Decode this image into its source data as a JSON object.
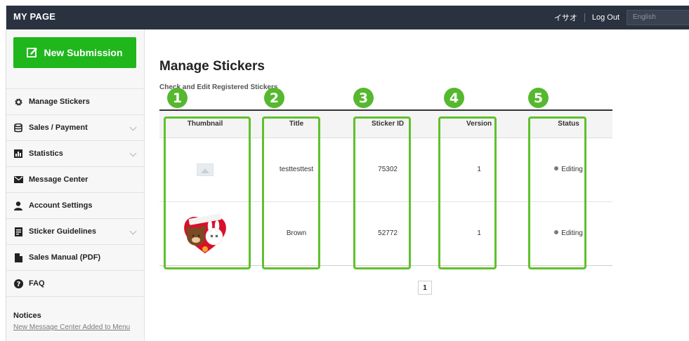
{
  "header": {
    "brand": "MY PAGE",
    "user_name": "イサオ",
    "logout": "Log Out",
    "language": "English"
  },
  "sidebar": {
    "new_submission": "New Submission",
    "items": [
      {
        "label": "Manage Stickers",
        "icon": "gear-icon"
      },
      {
        "label": "Sales / Payment",
        "icon": "database-icon"
      },
      {
        "label": "Statistics",
        "icon": "bar-chart-icon"
      },
      {
        "label": "Message Center",
        "icon": "envelope-icon"
      },
      {
        "label": "Account Settings",
        "icon": "person-icon"
      },
      {
        "label": "Sticker Guidelines",
        "icon": "document-icon"
      },
      {
        "label": "Sales Manual (PDF)",
        "icon": "file-icon"
      },
      {
        "label": "FAQ",
        "icon": "question-icon"
      }
    ],
    "notices_title": "Notices",
    "notice_link": "New Message Center Added to Menu"
  },
  "main": {
    "title": "Manage Stickers",
    "subtitle": "Check and Edit Registered Stickers",
    "table": {
      "headers": [
        "Thumbnail",
        "Title",
        "Sticker ID",
        "Version",
        "Status"
      ],
      "rows": [
        {
          "thumbnail": "placeholder-image-icon",
          "title": "testtesttest",
          "sticker_id": "75302",
          "version": "1",
          "status": "Editing"
        },
        {
          "thumbnail": "cony-brown-heart-sticker",
          "title": "Brown",
          "sticker_id": "52772",
          "version": "1",
          "status": "Editing"
        }
      ]
    },
    "pagination": {
      "current_page": "1"
    }
  },
  "annotations": {
    "color": "#5fc12c",
    "badges": [
      "1",
      "2",
      "3",
      "4",
      "5"
    ]
  },
  "colors": {
    "topbar": "#2a3240",
    "new_submission": "#1fb71c"
  }
}
